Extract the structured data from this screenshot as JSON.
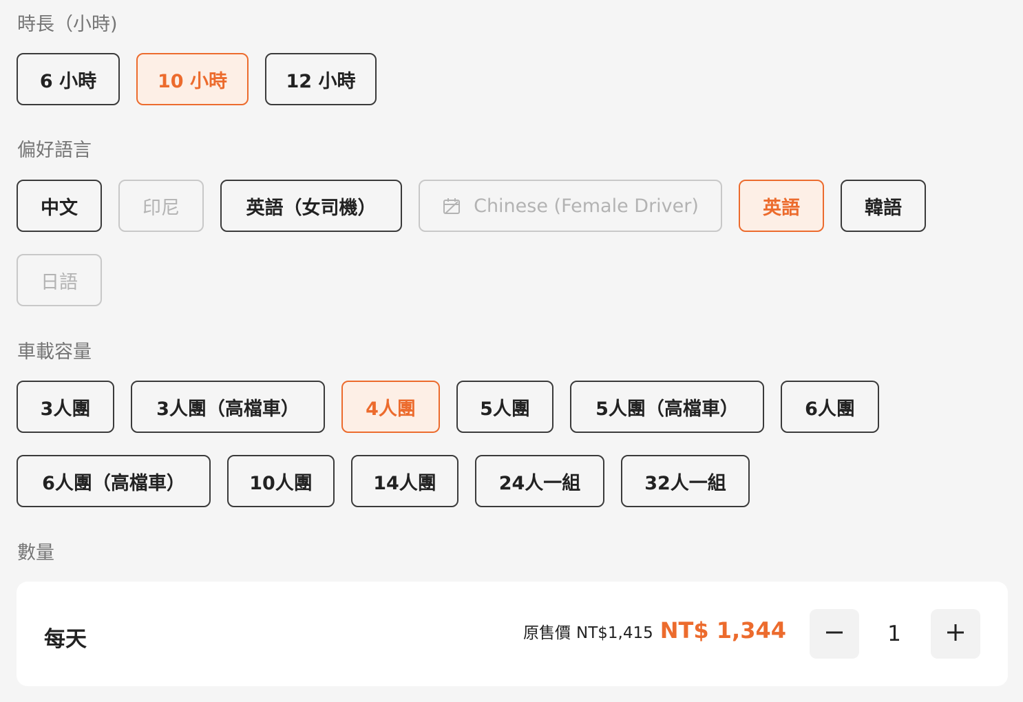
{
  "duration": {
    "label": "時長（小時)",
    "options": [
      {
        "label": "6 小時",
        "state": "default"
      },
      {
        "label": "10 小時",
        "state": "selected"
      },
      {
        "label": "12 小時",
        "state": "default"
      }
    ]
  },
  "language": {
    "label": "偏好語言",
    "options": [
      {
        "label": "中文",
        "state": "default"
      },
      {
        "label": "印尼",
        "state": "disabled"
      },
      {
        "label": "英語（女司機）",
        "state": "default"
      },
      {
        "label": "Chinese (Female Driver)",
        "state": "disabled",
        "icon": "calendar-unavailable-icon"
      },
      {
        "label": "英語",
        "state": "selected"
      },
      {
        "label": "韓語",
        "state": "default"
      },
      {
        "label": "日語",
        "state": "disabled"
      }
    ]
  },
  "capacity": {
    "label": "車載容量",
    "options": [
      {
        "label": "3人團",
        "state": "default"
      },
      {
        "label": "3人團（高檔車）",
        "state": "default"
      },
      {
        "label": "4人團",
        "state": "selected"
      },
      {
        "label": "5人團",
        "state": "default"
      },
      {
        "label": "5人團（高檔車）",
        "state": "default"
      },
      {
        "label": "6人團",
        "state": "default"
      },
      {
        "label": "6人團（高檔車）",
        "state": "default"
      },
      {
        "label": "10人團",
        "state": "default"
      },
      {
        "label": "14人團",
        "state": "default"
      },
      {
        "label": "24人一組",
        "state": "default"
      },
      {
        "label": "32人一組",
        "state": "default"
      }
    ]
  },
  "quantity": {
    "label": "數量",
    "unit_label": "每天",
    "original_price_label": "原售價",
    "original_price": "NT$1,415",
    "sale_price": "NT$ 1,344",
    "value": "1",
    "decrement_icon": "minus-icon",
    "increment_icon": "plus-icon"
  },
  "colors": {
    "accent": "#ec6b2d",
    "selected_bg": "#fdefe6",
    "border": "#3a3a3a",
    "disabled_border": "#c8c8c8",
    "disabled_text": "#b3b3b3",
    "page_bg": "#f5f5f5"
  }
}
